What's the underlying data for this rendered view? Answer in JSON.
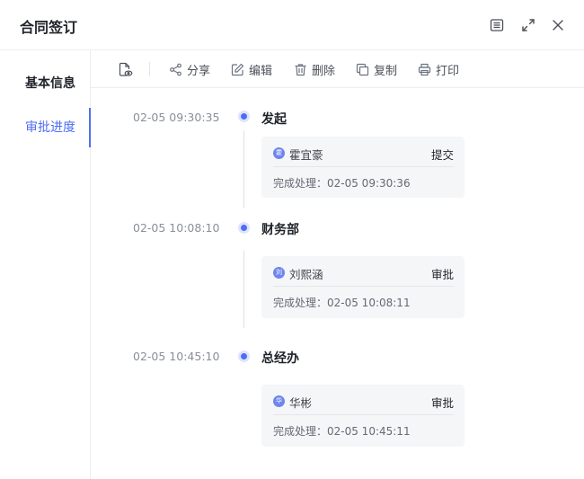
{
  "header": {
    "title": "合同签订"
  },
  "sidebar": {
    "items": [
      {
        "label": "基本信息"
      },
      {
        "label": "审批进度"
      }
    ]
  },
  "toolbar": {
    "share": "分享",
    "edit": "编辑",
    "delete": "删除",
    "copy": "复制",
    "print": "打印"
  },
  "timeline": [
    {
      "time": "02-05 09:30:35",
      "title": "发起",
      "avatar": "霍",
      "user": "霍宜豪",
      "action": "提交",
      "detail": "完成处理：02-05 09:30:36"
    },
    {
      "time": "02-05 10:08:10",
      "title": "财务部",
      "avatar": "刘",
      "user": "刘熙涵",
      "action": "审批",
      "detail": "完成处理：02-05 10:08:11"
    },
    {
      "time": "02-05 10:45:10",
      "title": "总经办",
      "avatar": "华",
      "user": "华彬",
      "action": "审批",
      "detail": "完成处理：02-05 10:45:11"
    }
  ],
  "colors": {
    "accent": "#4e6ef2",
    "avatar": "#6f86ee",
    "card_bg": "#f5f6f8"
  },
  "icons": {
    "header": [
      "panel-icon",
      "expand-icon",
      "close-icon"
    ],
    "toolbar": [
      "file-view-icon",
      "share-icon",
      "edit-icon",
      "trash-icon",
      "copy-icon",
      "printer-icon"
    ]
  }
}
